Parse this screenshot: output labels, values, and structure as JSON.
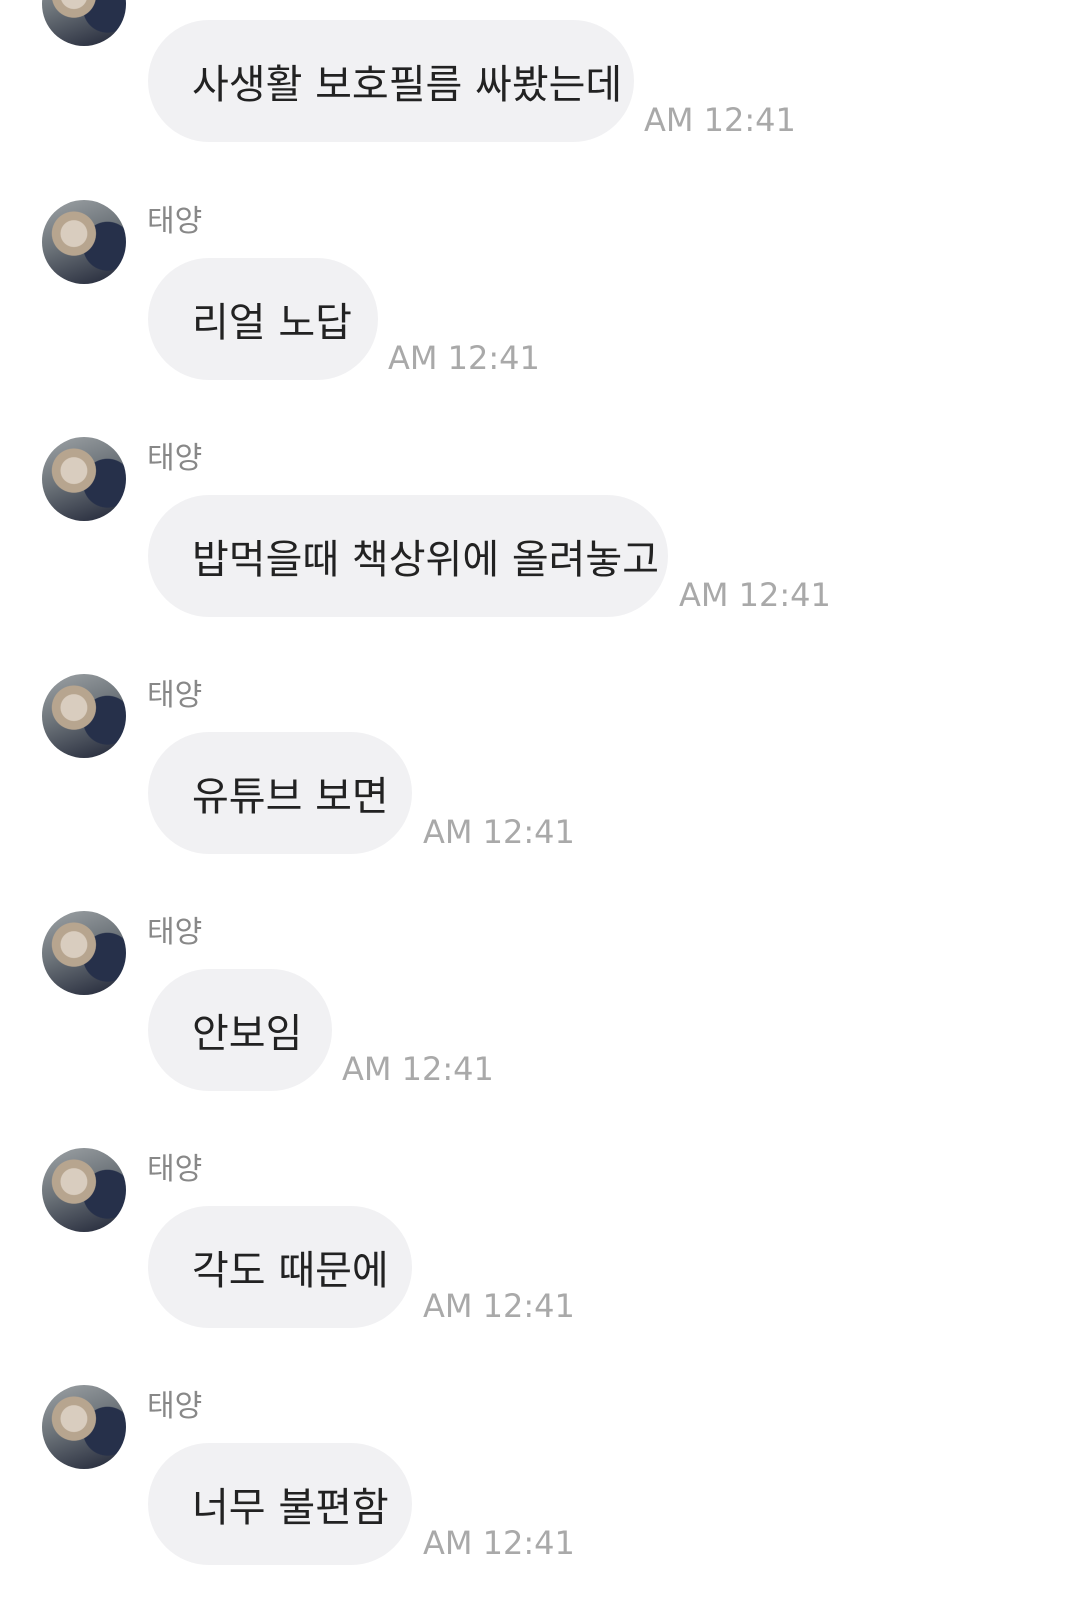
{
  "messages": [
    {
      "sender": "",
      "text": "사생활 보호필름 싸봤는데",
      "time": "AM 12:41"
    },
    {
      "sender": "태양",
      "text": "리얼 노답",
      "time": "AM 12:41"
    },
    {
      "sender": "태양",
      "text": "밥먹을때 책상위에 올려놓고",
      "time": "AM 12:41"
    },
    {
      "sender": "태양",
      "text": "유튜브 보면",
      "time": "AM 12:41"
    },
    {
      "sender": "태양",
      "text": "안보임",
      "time": "AM 12:41"
    },
    {
      "sender": "태양",
      "text": "각도 때문에",
      "time": "AM 12:41"
    },
    {
      "sender": "태양",
      "text": "너무 불편함",
      "time": "AM 12:41"
    }
  ],
  "colors": {
    "bubble": "#f1f1f3",
    "time": "#a9a9a9",
    "sender": "#888888",
    "text": "#222222"
  },
  "icons": {
    "avatar": "user-photo-avatar"
  }
}
